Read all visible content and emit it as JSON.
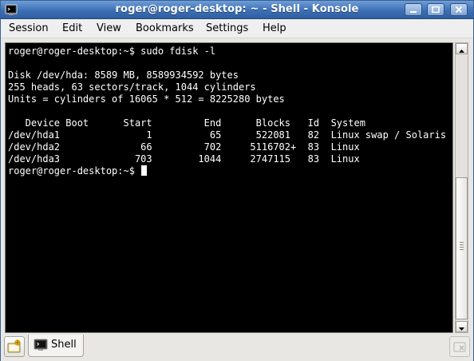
{
  "window": {
    "title": "roger@roger-desktop: ~ - Shell - Konsole"
  },
  "menubar": {
    "items": [
      "Session",
      "Edit",
      "View",
      "Bookmarks",
      "Settings",
      "Help"
    ]
  },
  "terminal": {
    "lines": [
      "roger@roger-desktop:~$ sudo fdisk -l",
      "",
      "Disk /dev/hda: 8589 MB, 8589934592 bytes",
      "255 heads, 63 sectors/track, 1044 cylinders",
      "Units = cylinders of 16065 * 512 = 8225280 bytes",
      "",
      "   Device Boot      Start         End      Blocks   Id  System",
      "/dev/hda1               1          65      522081   82  Linux swap / Solaris",
      "/dev/hda2              66         702     5116702+  83  Linux",
      "/dev/hda3             703        1044     2747115   83  Linux"
    ],
    "prompt": "roger@roger-desktop:~$ "
  },
  "tabs": [
    {
      "label": "Shell",
      "icon": "terminal-icon"
    }
  ],
  "icons": {
    "app": "konsole-icon",
    "new_tab": "new-session-icon",
    "close_tab": "close-session-icon"
  },
  "colors": {
    "titlebar": "#3d6fb5",
    "terminal_bg": "#000000",
    "terminal_fg": "#ffffff"
  }
}
